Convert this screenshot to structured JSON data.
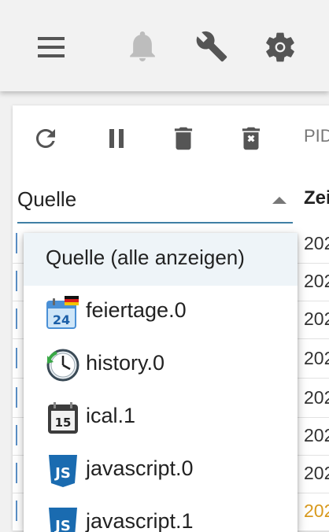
{
  "appbar": {
    "icons": [
      "menu-icon",
      "bell-icon",
      "wrench-icon",
      "gear-icon"
    ],
    "colors": {
      "active": "#555555",
      "disabled": "#bdbdbd"
    }
  },
  "toolbar": {
    "icons": [
      "refresh-icon",
      "pause-icon",
      "delete-icon",
      "clear-log-icon"
    ],
    "pid_label": "PID"
  },
  "filter": {
    "value": "Quelle",
    "accent": "#3f7fa4"
  },
  "table": {
    "time_header": "Zei",
    "rows": [
      {
        "time": "202"
      },
      {
        "time": "202"
      },
      {
        "time": "202"
      },
      {
        "time": "202"
      },
      {
        "time": "202"
      },
      {
        "time": "202"
      },
      {
        "time": "202"
      },
      {
        "time": "202"
      }
    ]
  },
  "menu": {
    "all_label": "Quelle (alle anzeigen)",
    "items": [
      {
        "label": "feiertage.0",
        "icon": "calendar-24-icon"
      },
      {
        "label": "history.0",
        "icon": "history-clock-icon"
      },
      {
        "label": "ical.1",
        "icon": "calendar-15-icon"
      },
      {
        "label": "javascript.0",
        "icon": "javascript-icon"
      },
      {
        "label": "javascript.1",
        "icon": "javascript-icon"
      }
    ],
    "icon_text": {
      "calendar_day": "24",
      "ical_day": "15",
      "js": "JS"
    }
  }
}
